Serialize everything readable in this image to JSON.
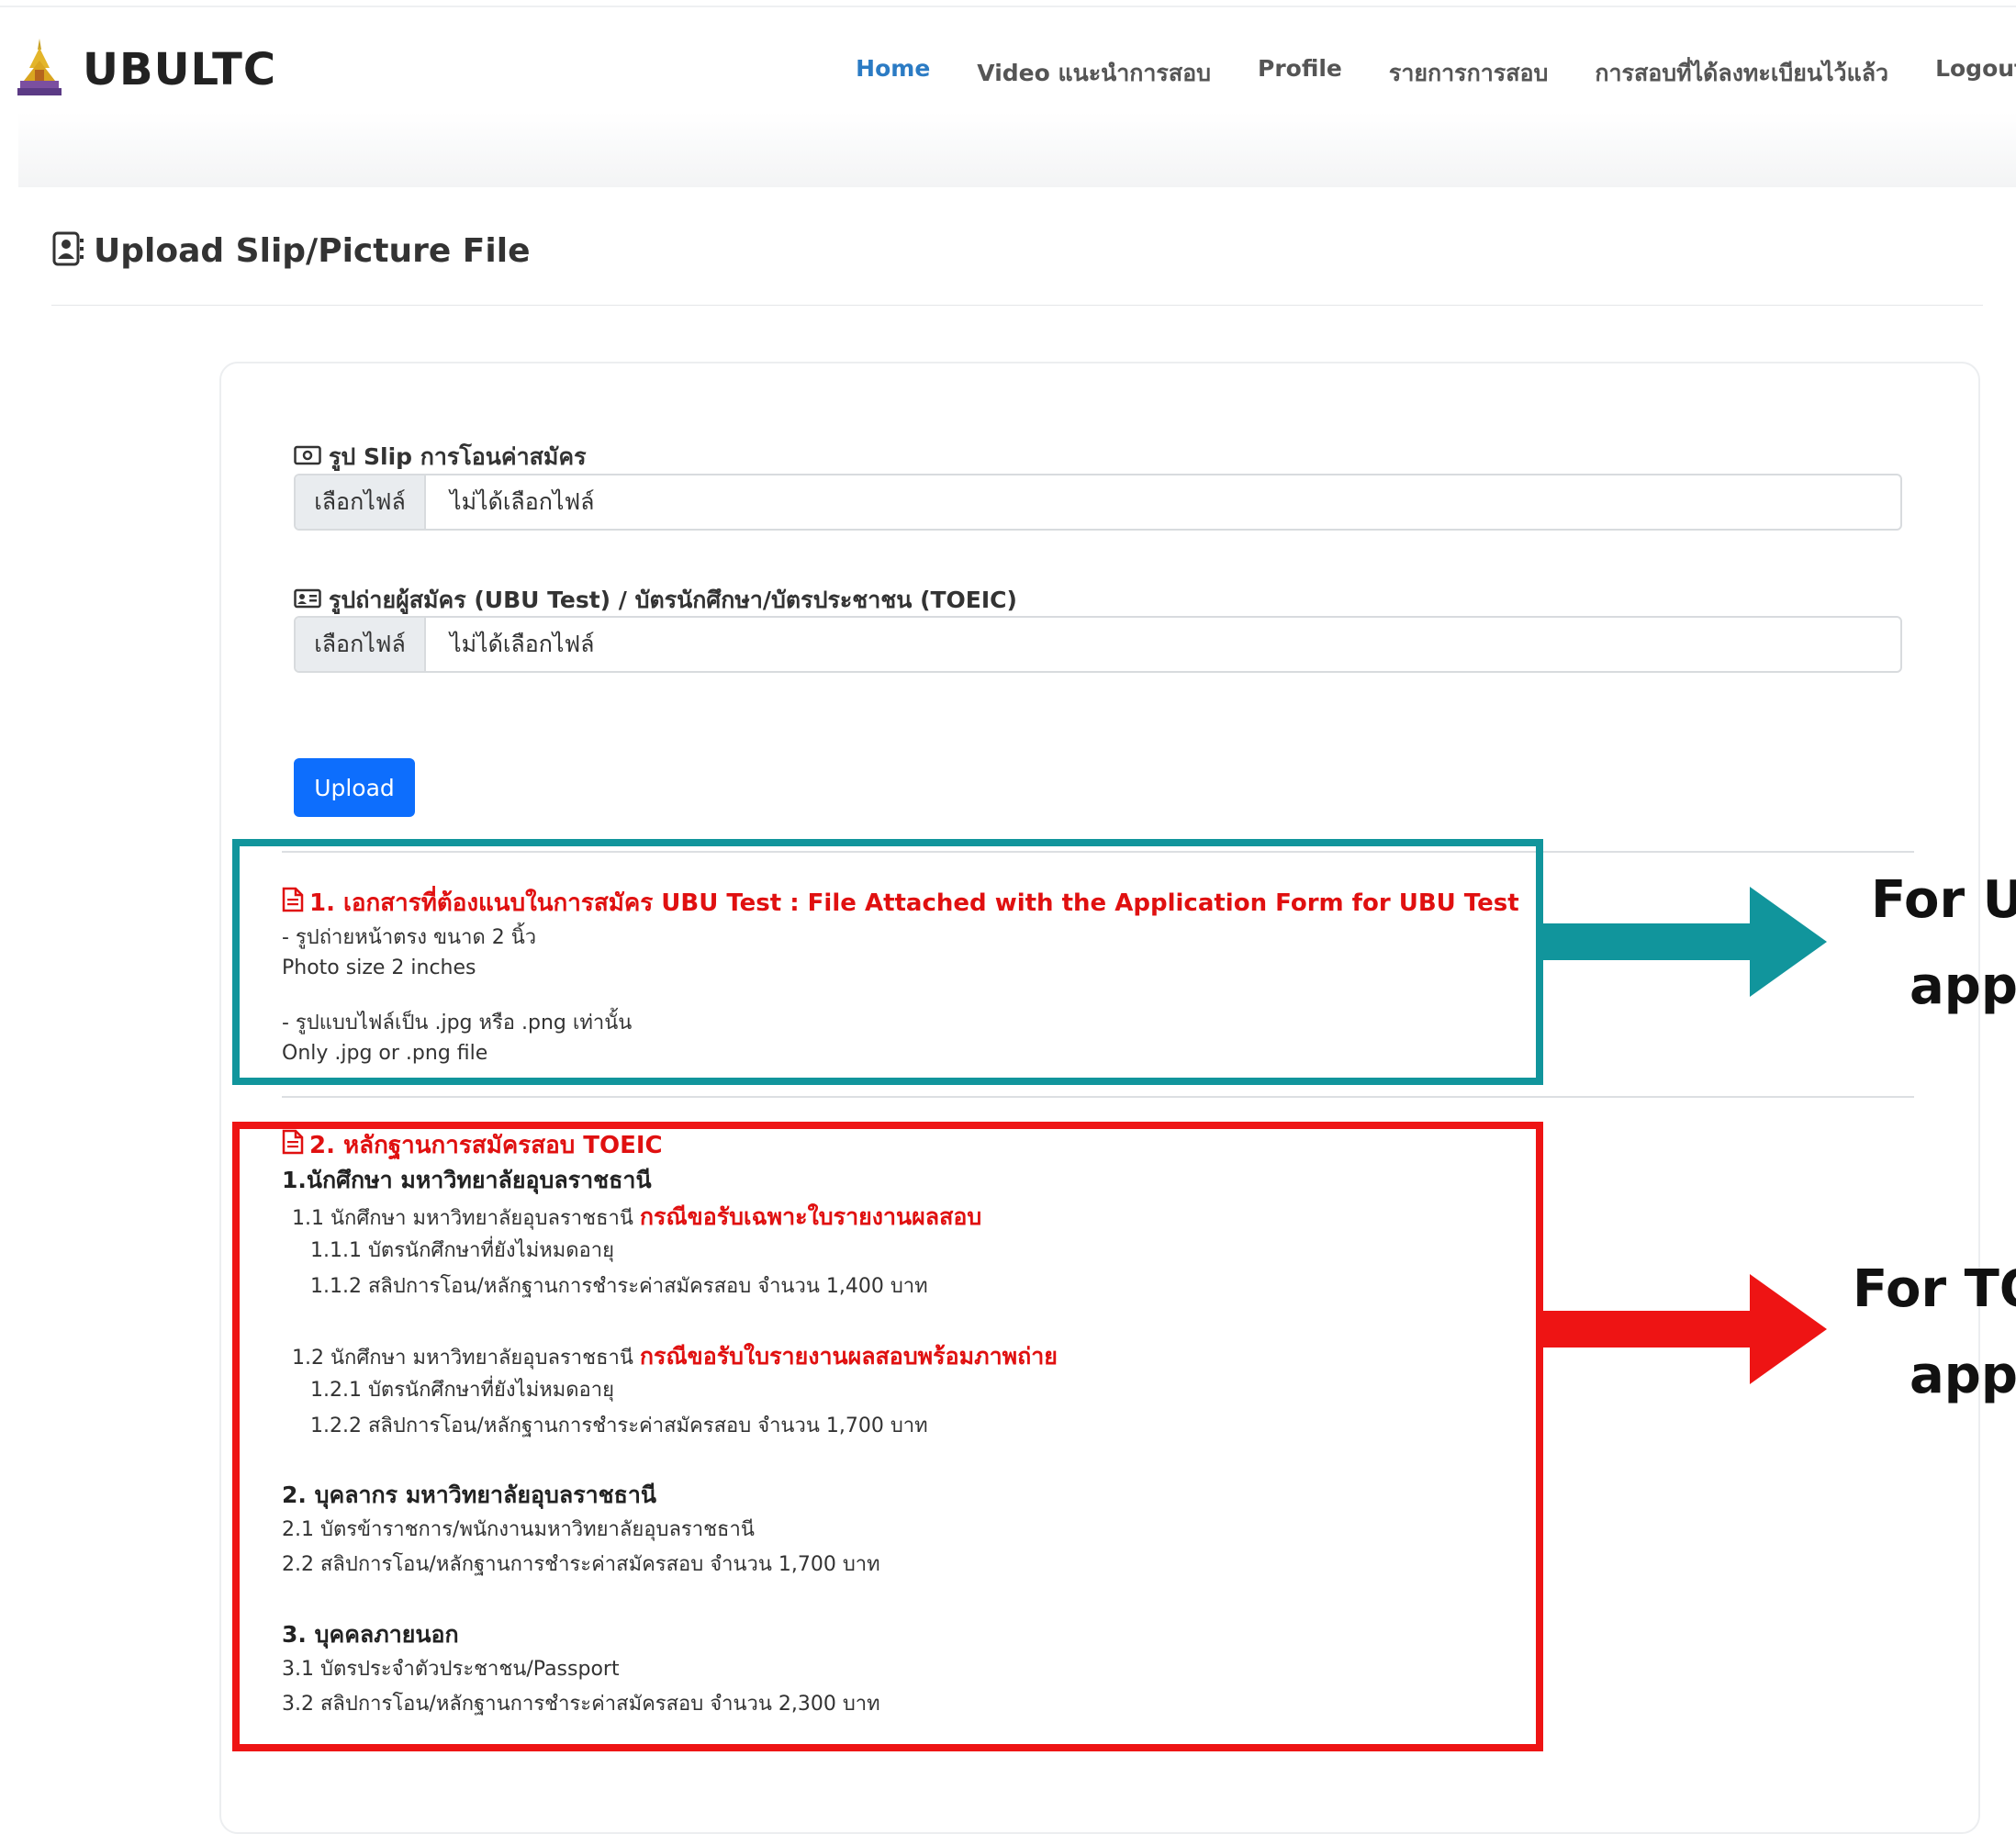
{
  "navbar": {
    "brand": "UBULTC",
    "items": [
      {
        "label": "Home",
        "active": true
      },
      {
        "label": "Video แนะนำการสอบ",
        "active": false
      },
      {
        "label": "Profile",
        "active": false
      },
      {
        "label": "รายการการสอบ",
        "active": false
      },
      {
        "label": "การสอบที่ได้ลงทะเบียนไว้แล้ว",
        "active": false
      },
      {
        "label": "Logout",
        "active": false
      }
    ]
  },
  "page": {
    "title": "Upload Slip/Picture File"
  },
  "form": {
    "slip": {
      "label": "รูป Slip การโอนค่าสมัคร",
      "button": "เลือกไฟล์",
      "status": "ไม่ได้เลือกไฟล์"
    },
    "photo": {
      "label": "รูปถ่ายผู้สมัคร (UBU Test) / บัตรนักศึกษา/บัตรประชาชน (TOEIC)",
      "button": "เลือกไฟล์",
      "status": "ไม่ได้เลือกไฟล์"
    },
    "upload": "Upload"
  },
  "section1": {
    "title": "1. เอกสารที่ต้องแนบในการสมัคร UBU Test : File Attached with the Application Form for UBU Test",
    "l1": "- รูปถ่ายหน้าตรง ขนาด 2 นิ้ว",
    "l2": "Photo size 2 inches",
    "l3": "- รูปแบบไฟล์เป็น .jpg หรือ .png เท่านั้น",
    "l4": "Only .jpg or .png file"
  },
  "section2": {
    "title": "2. หลักฐานการสมัครสอบ TOEIC",
    "g1": {
      "heading": "1.นักศึกษา มหาวิทยาลัยอุบลราชธานี",
      "s1_prefix": "1.1 นักศึกษา มหาวิทยาลัยอุบลราชธานี",
      "s1_emph": "กรณีขอรับเฉพาะใบรายงานผลสอบ",
      "s1_1": "1.1.1 บัตรนักศึกษาที่ยังไม่หมดอายุ",
      "s1_2": "1.1.2 สลิปการโอน/หลักฐานการชำระค่าสมัครสอบ จำนวน 1,400 บาท",
      "s2_prefix": "1.2 นักศึกษา มหาวิทยาลัยอุบลราชธานี",
      "s2_emph": "กรณีขอรับใบรายงานผลสอบพร้อมภาพถ่าย",
      "s2_1": "1.2.1 บัตรนักศึกษาที่ยังไม่หมดอายุ",
      "s2_2": "1.2.2 สลิปการโอน/หลักฐานการชำระค่าสมัครสอบ จำนวน 1,700 บาท"
    },
    "g2": {
      "heading": "2. บุคลากร มหาวิทยาลัยอุบลราชธานี",
      "l1": "2.1 บัตรข้าราชการ/พนักงานมหาวิทยาลัยอุบลราชธานี",
      "l2": "2.2 สลิปการโอน/หลักฐานการชำระค่าสมัครสอบ จำนวน 1,700 บาท"
    },
    "g3": {
      "heading": "3. บุคคลภายนอก",
      "l1": "3.1 บัตรประจำตัวประชาชน/Passport",
      "l2": "3.2 สลิปการโอน/หลักฐานการชำระค่าสมัครสอบ จำนวน 2,300 บาท"
    }
  },
  "annotations": {
    "ubu_l1": "For U",
    "ubu_l2": "app",
    "toeic_l1": "For TO",
    "toeic_l2": "app",
    "teal": "#11959c",
    "red": "#ee1414"
  }
}
